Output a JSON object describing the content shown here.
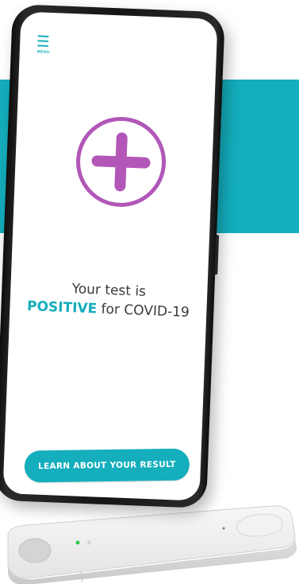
{
  "menu": {
    "label": "MENU"
  },
  "result": {
    "line1": "Your test is",
    "status": "POSITIVE",
    "suffix": " for COVID-19"
  },
  "actions": {
    "learn_label": "LEARN ABOUT YOUR RESULT"
  },
  "colors": {
    "accent": "#14aebd",
    "positive_icon": "#b257b8",
    "text": "#3b3b3b"
  },
  "icons": {
    "menu": "hamburger-icon",
    "result": "plus-circle-icon"
  }
}
